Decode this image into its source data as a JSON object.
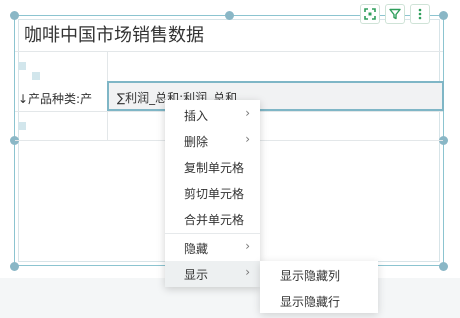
{
  "table": {
    "title": "咖啡中国市场销售数据",
    "row_header": "↓产品种类:产",
    "selected_cell": "∑利润_总和:利润_总和"
  },
  "toolbar": {
    "icons": [
      "fullscreen-icon",
      "filter-icon",
      "more-vertical-icon"
    ],
    "accent": "#2e9e5b"
  },
  "context_menu": {
    "items": [
      {
        "label": "插入",
        "has_submenu": true
      },
      {
        "label": "删除",
        "has_submenu": true
      },
      {
        "label": "复制单元格",
        "has_submenu": false
      },
      {
        "label": "剪切单元格",
        "has_submenu": false
      },
      {
        "label": "合并单元格",
        "has_submenu": false
      },
      {
        "label": "隐藏",
        "has_submenu": true
      },
      {
        "label": "显示",
        "has_submenu": true,
        "active": true
      }
    ],
    "submenu_arrow": "›"
  },
  "submenu": {
    "items": [
      {
        "label": "显示隐藏列"
      },
      {
        "label": "显示隐藏行"
      }
    ]
  }
}
